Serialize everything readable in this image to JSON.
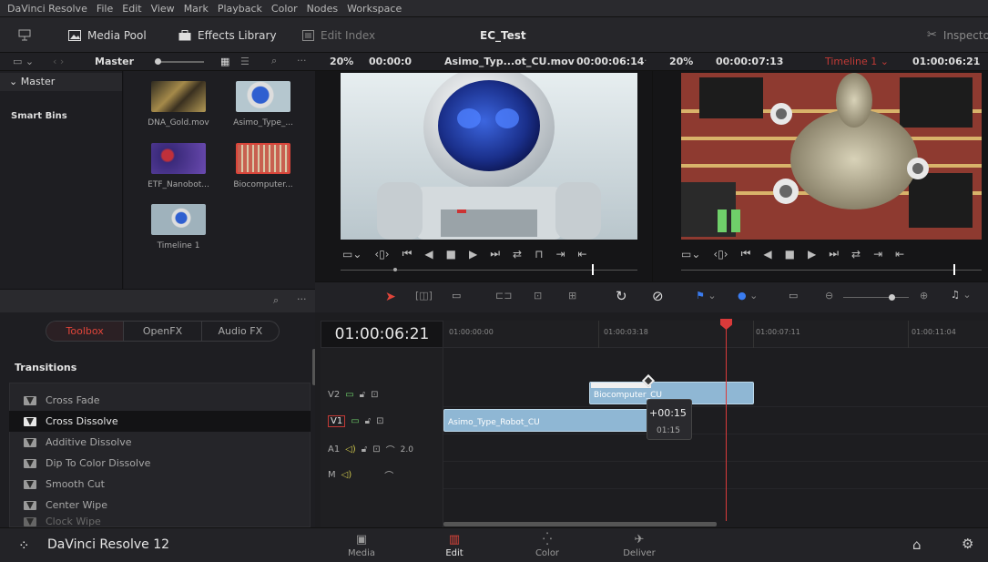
{
  "menu": [
    "DaVinci Resolve",
    "File",
    "Edit",
    "View",
    "Mark",
    "Playback",
    "Color",
    "Nodes",
    "Workspace"
  ],
  "toolbar": {
    "media_pool": "Media Pool",
    "effects_library": "Effects Library",
    "edit_index": "Edit Index",
    "project_title": "EC_Test",
    "inspector": "Inspector"
  },
  "subbar": {
    "bin_name": "Master",
    "src_zoom": "20%",
    "src_tc": "00:00:0",
    "src_clip": "Asimo_Typ...ot_CU.mov",
    "src_duration": "00:00:06:14",
    "tl_zoom": "20%",
    "tl_tc": "00:00:07:13",
    "timeline_name": "Timeline 1",
    "tl_position": "01:00:06:21"
  },
  "bins": {
    "master": "Master",
    "smart_bins": "Smart Bins"
  },
  "clips": [
    {
      "label": "DNA_Gold.mov"
    },
    {
      "label": "Asimo_Type_..."
    },
    {
      "label": "ETF_Nanobot..."
    },
    {
      "label": "Biocomputer..."
    },
    {
      "label": "Timeline 1"
    }
  ],
  "toolbox": {
    "tabs": [
      "Toolbox",
      "OpenFX",
      "Audio FX"
    ],
    "active": "Toolbox",
    "section": "Transitions"
  },
  "transitions": [
    "Cross Fade",
    "Cross Dissolve",
    "Additive Dissolve",
    "Dip To Color Dissolve",
    "Smooth Cut",
    "Center Wipe",
    "Clock Wipe"
  ],
  "timeline": {
    "timecode": "01:00:06:21",
    "ruler": [
      "01:00:00:00",
      "01:00:03:18",
      "01:00:07:11",
      "01:00:11:04"
    ],
    "tracks": [
      {
        "id": "V2"
      },
      {
        "id": "V1"
      },
      {
        "id": "A1",
        "level": "2.0"
      },
      {
        "id": "M"
      }
    ],
    "clips": {
      "v2": "Biocomputer_CU",
      "v1": "Asimo_Type_Robot_CU"
    },
    "tooltip": {
      "line1": "+00:15",
      "line2": "01:15"
    }
  },
  "footer": {
    "app": "DaVinci Resolve 12",
    "pages": [
      "Media",
      "Edit",
      "Color",
      "Deliver"
    ],
    "active_page": "Edit"
  },
  "colors": {
    "accent": "#e1453a",
    "clip_blue": "#8fb7d4",
    "playhead": "#d93a3a"
  }
}
